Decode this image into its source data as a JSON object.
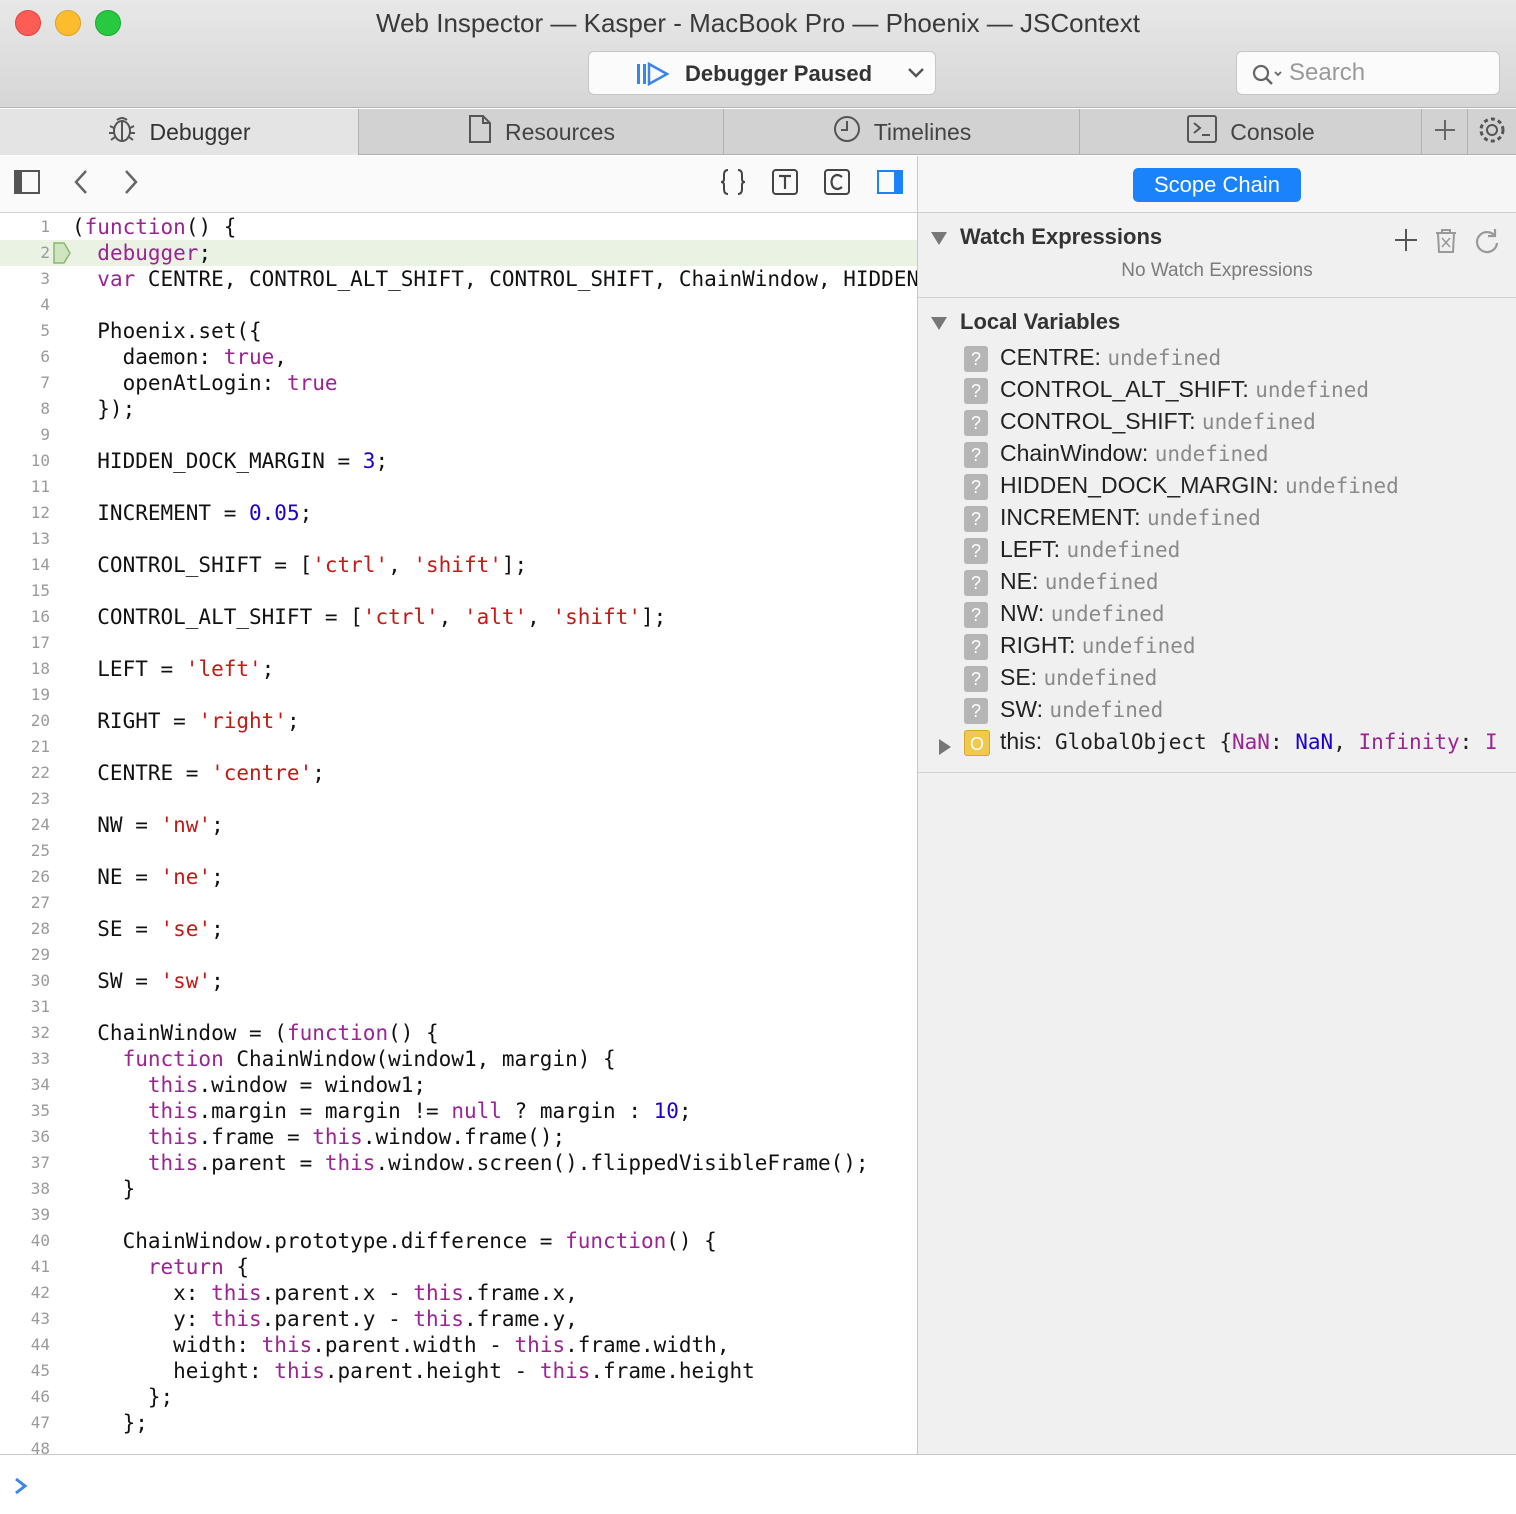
{
  "window": {
    "title": "Web Inspector — Kasper - MacBook Pro — Phoenix — JSContext"
  },
  "status": {
    "label": "Debugger Paused"
  },
  "search": {
    "placeholder": "Search"
  },
  "tabs": [
    {
      "label": "Debugger",
      "icon": "bug-icon"
    },
    {
      "label": "Resources",
      "icon": "document-icon"
    },
    {
      "label": "Timelines",
      "icon": "clock-icon"
    },
    {
      "label": "Console",
      "icon": "console-icon"
    }
  ],
  "sidebar": {
    "scope_button": "Scope Chain",
    "watch": {
      "title": "Watch Expressions",
      "empty": "No Watch Expressions"
    },
    "locals": {
      "title": "Local Variables",
      "items": [
        {
          "name": "CENTRE:",
          "value": "undefined"
        },
        {
          "name": "CONTROL_ALT_SHIFT:",
          "value": "undefined"
        },
        {
          "name": "CONTROL_SHIFT:",
          "value": "undefined"
        },
        {
          "name": "ChainWindow:",
          "value": "undefined"
        },
        {
          "name": "HIDDEN_DOCK_MARGIN:",
          "value": "undefined"
        },
        {
          "name": "INCREMENT:",
          "value": "undefined"
        },
        {
          "name": "LEFT:",
          "value": "undefined"
        },
        {
          "name": "NE:",
          "value": "undefined"
        },
        {
          "name": "NW:",
          "value": "undefined"
        },
        {
          "name": "RIGHT:",
          "value": "undefined"
        },
        {
          "name": "SE:",
          "value": "undefined"
        },
        {
          "name": "SW:",
          "value": "undefined"
        }
      ],
      "this_row": {
        "name": "this:",
        "type": "GlobalObject",
        "open": " {",
        "k1": "NaN",
        "sep1": ": ",
        "v1": "NaN",
        "comma": ", ",
        "k2": "Infinity",
        "sep2": ": ",
        "v2": "I"
      }
    }
  },
  "code": {
    "current_line": 2,
    "lines": [
      [
        [
          "(",
          ""
        ],
        [
          "function",
          "kw"
        ],
        [
          "() {",
          ""
        ]
      ],
      [
        [
          "  ",
          ""
        ],
        [
          "debugger",
          "kw"
        ],
        [
          ";",
          ""
        ]
      ],
      [
        [
          "  ",
          ""
        ],
        [
          "var",
          "kw"
        ],
        [
          " CENTRE, CONTROL_ALT_SHIFT, CONTROL_SHIFT, ChainWindow, HIDDEN_DOCK_MARGIN",
          ""
        ]
      ],
      [],
      [
        [
          "  Phoenix.set({",
          ""
        ]
      ],
      [
        [
          "    daemon: ",
          ""
        ],
        [
          "true",
          "kw"
        ],
        [
          ",",
          ""
        ]
      ],
      [
        [
          "    openAtLogin: ",
          ""
        ],
        [
          "true",
          "kw"
        ]
      ],
      [
        [
          "  });",
          ""
        ]
      ],
      [],
      [
        [
          "  HIDDEN_DOCK_MARGIN = ",
          ""
        ],
        [
          "3",
          "num"
        ],
        [
          ";",
          ""
        ]
      ],
      [],
      [
        [
          "  INCREMENT = ",
          ""
        ],
        [
          "0.05",
          "num"
        ],
        [
          ";",
          ""
        ]
      ],
      [],
      [
        [
          "  CONTROL_SHIFT = [",
          ""
        ],
        [
          "'ctrl'",
          "str"
        ],
        [
          ", ",
          ""
        ],
        [
          "'shift'",
          "str"
        ],
        [
          "];",
          ""
        ]
      ],
      [],
      [
        [
          "  CONTROL_ALT_SHIFT = [",
          ""
        ],
        [
          "'ctrl'",
          "str"
        ],
        [
          ", ",
          ""
        ],
        [
          "'alt'",
          "str"
        ],
        [
          ", ",
          ""
        ],
        [
          "'shift'",
          "str"
        ],
        [
          "];",
          ""
        ]
      ],
      [],
      [
        [
          "  LEFT = ",
          ""
        ],
        [
          "'left'",
          "str"
        ],
        [
          ";",
          ""
        ]
      ],
      [],
      [
        [
          "  RIGHT = ",
          ""
        ],
        [
          "'right'",
          "str"
        ],
        [
          ";",
          ""
        ]
      ],
      [],
      [
        [
          "  CENTRE = ",
          ""
        ],
        [
          "'centre'",
          "str"
        ],
        [
          ";",
          ""
        ]
      ],
      [],
      [
        [
          "  NW = ",
          ""
        ],
        [
          "'nw'",
          "str"
        ],
        [
          ";",
          ""
        ]
      ],
      [],
      [
        [
          "  NE = ",
          ""
        ],
        [
          "'ne'",
          "str"
        ],
        [
          ";",
          ""
        ]
      ],
      [],
      [
        [
          "  SE = ",
          ""
        ],
        [
          "'se'",
          "str"
        ],
        [
          ";",
          ""
        ]
      ],
      [],
      [
        [
          "  SW = ",
          ""
        ],
        [
          "'sw'",
          "str"
        ],
        [
          ";",
          ""
        ]
      ],
      [],
      [
        [
          "  ChainWindow = (",
          ""
        ],
        [
          "function",
          "kw"
        ],
        [
          "() {",
          ""
        ]
      ],
      [
        [
          "    ",
          ""
        ],
        [
          "function",
          "kw"
        ],
        [
          " ChainWindow(window1, margin) {",
          ""
        ]
      ],
      [
        [
          "      ",
          ""
        ],
        [
          "this",
          "kw"
        ],
        [
          ".window = window1;",
          ""
        ]
      ],
      [
        [
          "      ",
          ""
        ],
        [
          "this",
          "kw"
        ],
        [
          ".margin = margin != ",
          ""
        ],
        [
          "null",
          "kw"
        ],
        [
          " ? margin : ",
          ""
        ],
        [
          "10",
          "num"
        ],
        [
          ";",
          ""
        ]
      ],
      [
        [
          "      ",
          ""
        ],
        [
          "this",
          "kw"
        ],
        [
          ".frame = ",
          ""
        ],
        [
          "this",
          "kw"
        ],
        [
          ".window.frame();",
          ""
        ]
      ],
      [
        [
          "      ",
          ""
        ],
        [
          "this",
          "kw"
        ],
        [
          ".parent = ",
          ""
        ],
        [
          "this",
          "kw"
        ],
        [
          ".window.screen().flippedVisibleFrame();",
          ""
        ]
      ],
      [
        [
          "    }",
          ""
        ]
      ],
      [],
      [
        [
          "    ChainWindow.prototype.difference = ",
          ""
        ],
        [
          "function",
          "kw"
        ],
        [
          "() {",
          ""
        ]
      ],
      [
        [
          "      ",
          ""
        ],
        [
          "return",
          "kw"
        ],
        [
          " {",
          ""
        ]
      ],
      [
        [
          "        x: ",
          ""
        ],
        [
          "this",
          "kw"
        ],
        [
          ".parent.x - ",
          ""
        ],
        [
          "this",
          "kw"
        ],
        [
          ".frame.x,",
          ""
        ]
      ],
      [
        [
          "        y: ",
          ""
        ],
        [
          "this",
          "kw"
        ],
        [
          ".parent.y - ",
          ""
        ],
        [
          "this",
          "kw"
        ],
        [
          ".frame.y,",
          ""
        ]
      ],
      [
        [
          "        width: ",
          ""
        ],
        [
          "this",
          "kw"
        ],
        [
          ".parent.width - ",
          ""
        ],
        [
          "this",
          "kw"
        ],
        [
          ".frame.width,",
          ""
        ]
      ],
      [
        [
          "        height: ",
          ""
        ],
        [
          "this",
          "kw"
        ],
        [
          ".parent.height - ",
          ""
        ],
        [
          "this",
          "kw"
        ],
        [
          ".frame.height",
          ""
        ]
      ],
      [
        [
          "      };",
          ""
        ]
      ],
      [
        [
          "    };",
          ""
        ]
      ],
      []
    ]
  },
  "colors": {
    "accent": "#1a82fb",
    "keyword": "#9b2393",
    "string": "#c41a16",
    "number": "#1c00cf",
    "current_line": "#e9f2e3"
  }
}
